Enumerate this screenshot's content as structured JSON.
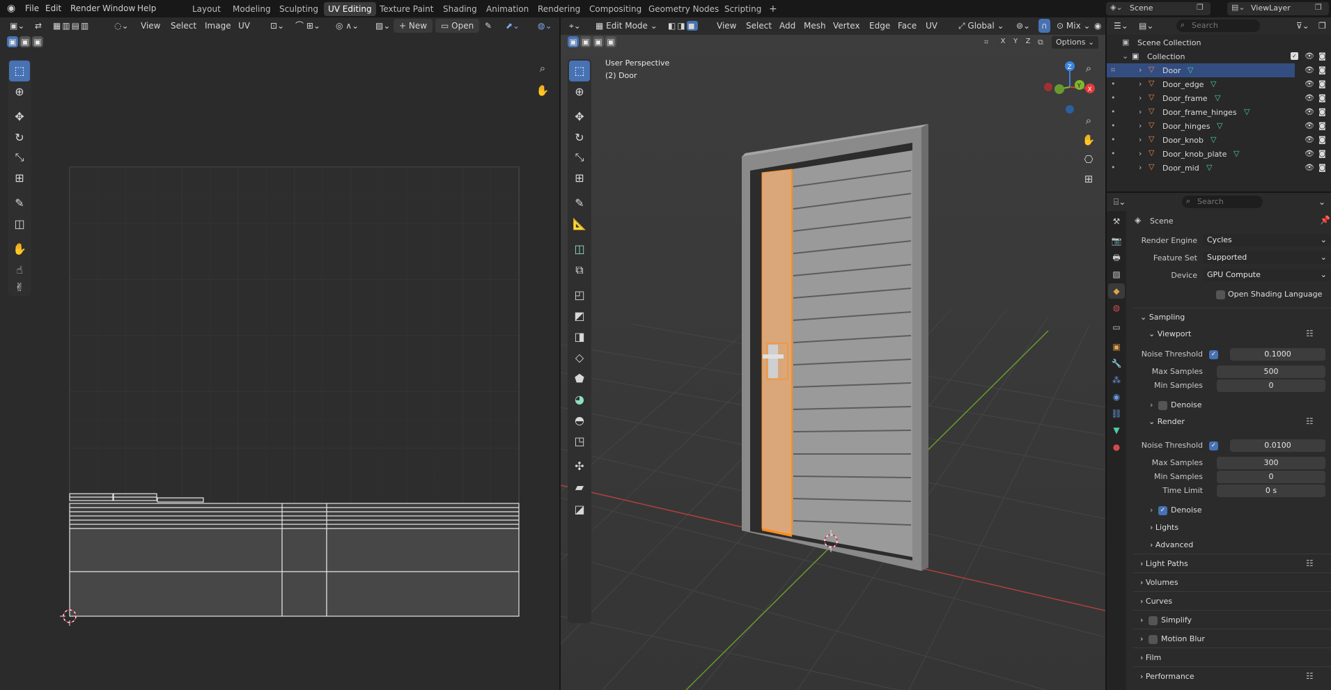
{
  "menu": {
    "file": "File",
    "edit": "Edit",
    "render": "Render",
    "window": "Window",
    "help": "Help"
  },
  "workspaces": [
    "Layout",
    "Modeling",
    "Sculpting",
    "UV Editing",
    "Texture Paint",
    "Shading",
    "Animation",
    "Rendering",
    "Compositing",
    "Geometry Nodes",
    "Scripting"
  ],
  "top_right": {
    "scene": "Scene",
    "view_layer": "ViewLayer"
  },
  "uv_header": {
    "view": "View",
    "select": "Select",
    "image": "Image",
    "uv": "UV",
    "new": "New",
    "open": "Open"
  },
  "viewport_header": {
    "mode": "Edit Mode",
    "view": "View",
    "select": "Select",
    "add": "Add",
    "mesh": "Mesh",
    "vertex": "Vertex",
    "edge": "Edge",
    "face": "Face",
    "uv": "UV",
    "orientation": "Global",
    "shading": "Mix",
    "x": "X",
    "y": "Y",
    "z": "Z",
    "options": "Options"
  },
  "viewport": {
    "perspective": "User Perspective",
    "object": "(2) Door",
    "gizmo_x": "X",
    "gizmo_y": "Y",
    "gizmo_z": "Z"
  },
  "outliner": {
    "search_placeholder": "Search",
    "scene_collection": "Scene Collection",
    "collection": "Collection",
    "items": [
      "Door",
      "Door_edge",
      "Door_frame",
      "Door_frame_hinges",
      "Door_hinges",
      "Door_knob",
      "Door_knob_plate",
      "Door_mid"
    ]
  },
  "properties": {
    "search_placeholder": "Search",
    "context": "Scene",
    "render_engine_label": "Render Engine",
    "render_engine": "Cycles",
    "feature_set_label": "Feature Set",
    "feature_set": "Supported",
    "device_label": "Device",
    "device": "GPU Compute",
    "osl": "Open Shading Language",
    "sampling": "Sampling",
    "viewport": "Viewport",
    "render": "Render",
    "noise_threshold": "Noise Threshold",
    "max_samples": "Max Samples",
    "min_samples": "Min Samples",
    "time_limit": "Time Limit",
    "vp_noise": "0.1000",
    "vp_max": "500",
    "vp_min": "0",
    "denoise": "Denoise",
    "r_noise": "0.0100",
    "r_max": "300",
    "r_min": "0",
    "r_time": "0 s",
    "lights": "Lights",
    "advanced": "Advanced",
    "light_paths": "Light Paths",
    "volumes": "Volumes",
    "curves": "Curves",
    "simplify": "Simplify",
    "motion_blur": "Motion Blur",
    "film": "Film",
    "performance": "Performance"
  },
  "colors": {
    "accent": "#4772b3",
    "selection": "#334d80",
    "edit_highlight": "#ff8c1a",
    "mesh_icon": "#e8884a",
    "data_icon": "#4fd1a5",
    "x_axis": "#e23b3b",
    "y_axis": "#7fba2c",
    "z_axis": "#3a84e0"
  }
}
